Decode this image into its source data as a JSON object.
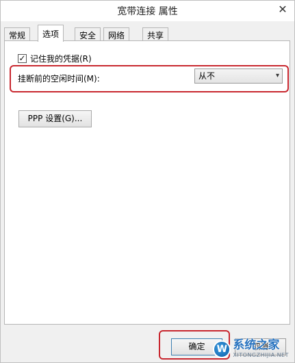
{
  "window": {
    "title": "宽带连接 属性",
    "close_glyph": "✕"
  },
  "tabs": [
    {
      "label": "常规",
      "active": false
    },
    {
      "label": "选项",
      "active": true
    },
    {
      "label": "安全",
      "active": false
    },
    {
      "label": "网络",
      "active": false
    },
    {
      "label": "共享",
      "active": false
    }
  ],
  "options": {
    "remember_credentials": {
      "label": "记住我的凭据(R)",
      "checked": true,
      "check_glyph": "✓"
    },
    "idle_hangup": {
      "label": "挂断前的空闲时间(M):",
      "value": "从不",
      "chevron": "▾"
    },
    "ppp_button": "PPP 设置(G)..."
  },
  "footer": {
    "ok_label": "确定",
    "cancel_label": "取消"
  },
  "watermark": {
    "logo_letter": "W",
    "text": "系统之家",
    "sub": "XITONGZHIJIA.NET"
  },
  "colors": {
    "highlight": "#c8262e",
    "accent": "#3c7fb1"
  },
  "icons": {
    "close": "close-icon",
    "checkbox": "checkmark-icon",
    "select": "chevron-down-icon"
  }
}
